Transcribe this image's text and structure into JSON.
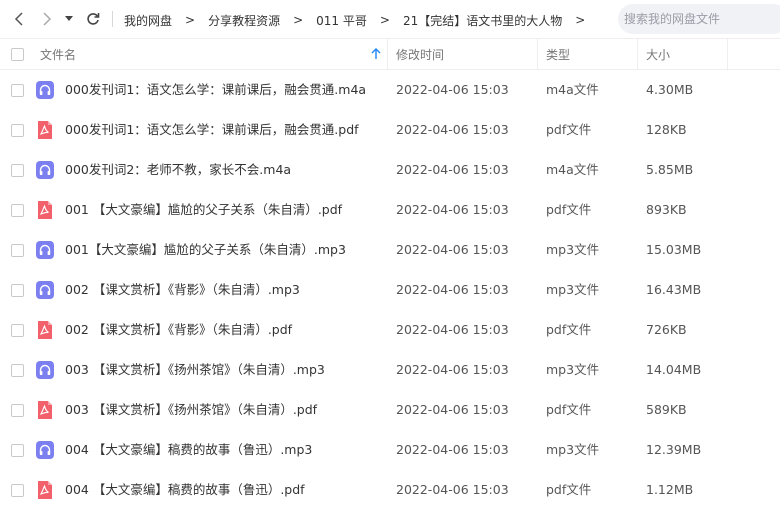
{
  "nav": {
    "back_icon": "chevron-left-icon",
    "forward_icon": "chevron-right-icon",
    "dropdown_icon": "caret-down-icon",
    "refresh_icon": "refresh-icon"
  },
  "breadcrumb": {
    "items": [
      "我的网盘",
      "分享教程资源",
      "011 平哥",
      "21【完结】语文书里的大人物"
    ],
    "separator": ">"
  },
  "search": {
    "placeholder": "搜索我的网盘文件"
  },
  "columns": {
    "name": "文件名",
    "modified": "修改时间",
    "type": "类型",
    "size": "大小",
    "sort_icon": "sort-arrow-up-icon"
  },
  "colors": {
    "audio_icon": "#7b7ff0",
    "pdf_icon": "#f2616b",
    "sort_arrow": "#2b8cf3"
  },
  "files": [
    {
      "icon": "audio",
      "name": "000发刊词1：语文怎么学：课前课后，融会贯通.m4a",
      "modified": "2022-04-06 15:03",
      "type": "m4a文件",
      "size": "4.30MB"
    },
    {
      "icon": "pdf",
      "name": "000发刊词1：语文怎么学：课前课后，融会贯通.pdf",
      "modified": "2022-04-06 15:03",
      "type": "pdf文件",
      "size": "128KB"
    },
    {
      "icon": "audio",
      "name": "000发刊词2：老师不教，家长不会.m4a",
      "modified": "2022-04-06 15:03",
      "type": "m4a文件",
      "size": "5.85MB"
    },
    {
      "icon": "pdf",
      "name": "001 【大文豪编】尴尬的父子关系（朱自清）.pdf",
      "modified": "2022-04-06 15:03",
      "type": "pdf文件",
      "size": "893KB"
    },
    {
      "icon": "audio",
      "name": "001【大文豪编】尴尬的父子关系（朱自清）.mp3",
      "modified": "2022-04-06 15:03",
      "type": "mp3文件",
      "size": "15.03MB"
    },
    {
      "icon": "audio",
      "name": "002 【课文赏析】《背影》（朱自清）.mp3",
      "modified": "2022-04-06 15:03",
      "type": "mp3文件",
      "size": "16.43MB"
    },
    {
      "icon": "pdf",
      "name": "002 【课文赏析】《背影》（朱自清）.pdf",
      "modified": "2022-04-06 15:03",
      "type": "pdf文件",
      "size": "726KB"
    },
    {
      "icon": "audio",
      "name": "003 【课文赏析】《扬州茶馆》（朱自清）.mp3",
      "modified": "2022-04-06 15:03",
      "type": "mp3文件",
      "size": "14.04MB"
    },
    {
      "icon": "pdf",
      "name": "003 【课文赏析】《扬州茶馆》（朱自清）.pdf",
      "modified": "2022-04-06 15:03",
      "type": "pdf文件",
      "size": "589KB"
    },
    {
      "icon": "audio",
      "name": "004 【大文豪编】稿费的故事（鲁迅）.mp3",
      "modified": "2022-04-06 15:03",
      "type": "mp3文件",
      "size": "12.39MB"
    },
    {
      "icon": "pdf",
      "name": "004 【大文豪编】稿费的故事（鲁迅）.pdf",
      "modified": "2022-04-06 15:03",
      "type": "pdf文件",
      "size": "1.12MB"
    }
  ]
}
